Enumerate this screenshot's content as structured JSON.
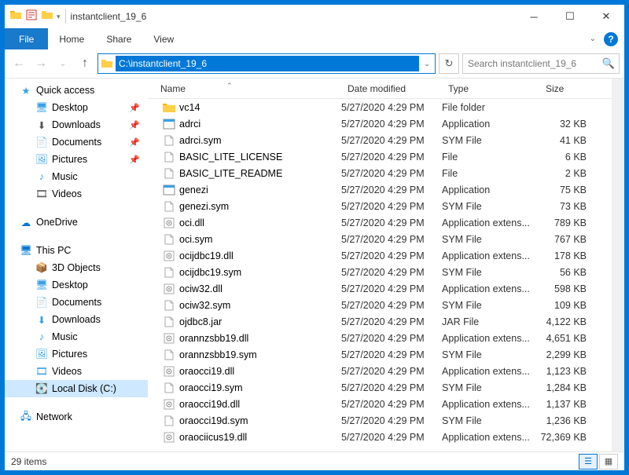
{
  "window": {
    "title": "instantclient_19_6"
  },
  "menubar": {
    "file": "File",
    "items": [
      "Home",
      "Share",
      "View"
    ]
  },
  "address": {
    "path": "C:\\instantclient_19_6"
  },
  "search": {
    "placeholder": "Search instantclient_19_6"
  },
  "nav_quick": {
    "label": "Quick access",
    "items": [
      {
        "label": "Desktop",
        "pin": true
      },
      {
        "label": "Downloads",
        "pin": true
      },
      {
        "label": "Documents",
        "pin": true
      },
      {
        "label": "Pictures",
        "pin": true
      },
      {
        "label": "Music",
        "pin": false
      },
      {
        "label": "Videos",
        "pin": false
      }
    ]
  },
  "nav_onedrive": {
    "label": "OneDrive"
  },
  "nav_pc": {
    "label": "This PC",
    "items": [
      {
        "label": "3D Objects"
      },
      {
        "label": "Desktop"
      },
      {
        "label": "Documents"
      },
      {
        "label": "Downloads"
      },
      {
        "label": "Music"
      },
      {
        "label": "Pictures"
      },
      {
        "label": "Videos"
      },
      {
        "label": "Local Disk (C:)",
        "selected": true
      }
    ]
  },
  "nav_network": {
    "label": "Network"
  },
  "columns": {
    "c1": "Name",
    "c2": "Date modified",
    "c3": "Type",
    "c4": "Size"
  },
  "files": [
    {
      "name": "vc14",
      "date": "5/27/2020 4:29 PM",
      "type": "File folder",
      "size": "",
      "icon": "folder"
    },
    {
      "name": "adrci",
      "date": "5/27/2020 4:29 PM",
      "type": "Application",
      "size": "32 KB",
      "icon": "app"
    },
    {
      "name": "adrci.sym",
      "date": "5/27/2020 4:29 PM",
      "type": "SYM File",
      "size": "41 KB",
      "icon": "file"
    },
    {
      "name": "BASIC_LITE_LICENSE",
      "date": "5/27/2020 4:29 PM",
      "type": "File",
      "size": "6 KB",
      "icon": "file"
    },
    {
      "name": "BASIC_LITE_README",
      "date": "5/27/2020 4:29 PM",
      "type": "File",
      "size": "2 KB",
      "icon": "file"
    },
    {
      "name": "genezi",
      "date": "5/27/2020 4:29 PM",
      "type": "Application",
      "size": "75 KB",
      "icon": "app"
    },
    {
      "name": "genezi.sym",
      "date": "5/27/2020 4:29 PM",
      "type": "SYM File",
      "size": "73 KB",
      "icon": "file"
    },
    {
      "name": "oci.dll",
      "date": "5/27/2020 4:29 PM",
      "type": "Application extens...",
      "size": "789 KB",
      "icon": "dll"
    },
    {
      "name": "oci.sym",
      "date": "5/27/2020 4:29 PM",
      "type": "SYM File",
      "size": "767 KB",
      "icon": "file"
    },
    {
      "name": "ocijdbc19.dll",
      "date": "5/27/2020 4:29 PM",
      "type": "Application extens...",
      "size": "178 KB",
      "icon": "dll"
    },
    {
      "name": "ocijdbc19.sym",
      "date": "5/27/2020 4:29 PM",
      "type": "SYM File",
      "size": "56 KB",
      "icon": "file"
    },
    {
      "name": "ociw32.dll",
      "date": "5/27/2020 4:29 PM",
      "type": "Application extens...",
      "size": "598 KB",
      "icon": "dll"
    },
    {
      "name": "ociw32.sym",
      "date": "5/27/2020 4:29 PM",
      "type": "SYM File",
      "size": "109 KB",
      "icon": "file"
    },
    {
      "name": "ojdbc8.jar",
      "date": "5/27/2020 4:29 PM",
      "type": "JAR File",
      "size": "4,122 KB",
      "icon": "file"
    },
    {
      "name": "orannzsbb19.dll",
      "date": "5/27/2020 4:29 PM",
      "type": "Application extens...",
      "size": "4,651 KB",
      "icon": "dll"
    },
    {
      "name": "orannzsbb19.sym",
      "date": "5/27/2020 4:29 PM",
      "type": "SYM File",
      "size": "2,299 KB",
      "icon": "file"
    },
    {
      "name": "oraocci19.dll",
      "date": "5/27/2020 4:29 PM",
      "type": "Application extens...",
      "size": "1,123 KB",
      "icon": "dll"
    },
    {
      "name": "oraocci19.sym",
      "date": "5/27/2020 4:29 PM",
      "type": "SYM File",
      "size": "1,284 KB",
      "icon": "file"
    },
    {
      "name": "oraocci19d.dll",
      "date": "5/27/2020 4:29 PM",
      "type": "Application extens...",
      "size": "1,137 KB",
      "icon": "dll"
    },
    {
      "name": "oraocci19d.sym",
      "date": "5/27/2020 4:29 PM",
      "type": "SYM File",
      "size": "1,236 KB",
      "icon": "file"
    },
    {
      "name": "oraociicus19.dll",
      "date": "5/27/2020 4:29 PM",
      "type": "Application extens...",
      "size": "72,369 KB",
      "icon": "dll"
    }
  ],
  "status": {
    "count": "29 items"
  }
}
